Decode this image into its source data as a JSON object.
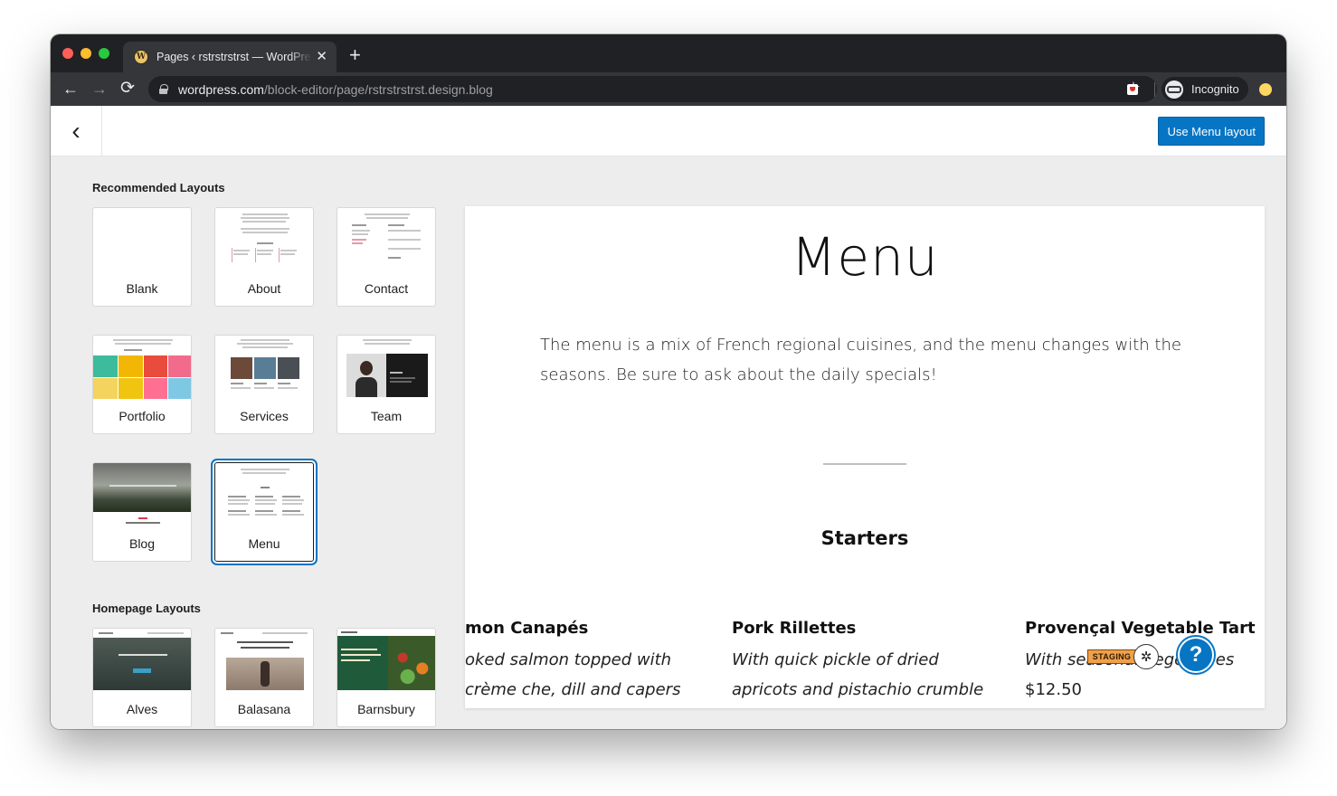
{
  "browser": {
    "tab_title": "Pages ‹ rstrstrstrst — WordPress.com",
    "tab_favicon": "W",
    "url_host": "wordpress.com",
    "url_path": "/block-editor/page/rstrstrstrst.design.blog",
    "profile_label": "Incognito"
  },
  "icons": {
    "back": "←",
    "forward": "→",
    "reload": "⟳",
    "star": "☆",
    "close": "✕",
    "new_tab": "+",
    "chevron_left": "‹",
    "bug": "✲",
    "help": "?"
  },
  "header": {
    "use_layout_button": "Use Menu layout"
  },
  "sidebar": {
    "recommended_title": "Recommended Layouts",
    "recommended": [
      {
        "label": "Blank"
      },
      {
        "label": "About"
      },
      {
        "label": "Contact"
      },
      {
        "label": "Portfolio"
      },
      {
        "label": "Services"
      },
      {
        "label": "Team"
      },
      {
        "label": "Blog"
      },
      {
        "label": "Menu",
        "selected": true
      }
    ],
    "homepage_title": "Homepage Layouts",
    "homepage": [
      {
        "label": "Alves"
      },
      {
        "label": "Balasana"
      },
      {
        "label": "Barnsbury"
      }
    ]
  },
  "preview": {
    "title": "Menu",
    "intro": "The menu is a mix of French regional cuisines, and the menu changes with the seasons. Be sure to ask about the daily specials!",
    "section_heading": "Starters",
    "items": [
      {
        "name": "mon Canapés",
        "description": "oked salmon topped with crème che, dill and capers"
      },
      {
        "name": "Pork Rillettes",
        "description": "With quick pickle of dried apricots and pistachio crumble"
      },
      {
        "name": "Provençal Vegetable Tart",
        "description": "With seasonal vegetables",
        "price": "$12.50"
      }
    ]
  },
  "badges": {
    "staging": "STAGING"
  },
  "colors": {
    "accent": "#0675c4",
    "chrome_dark": "#202124",
    "canvas": "#ededed"
  }
}
